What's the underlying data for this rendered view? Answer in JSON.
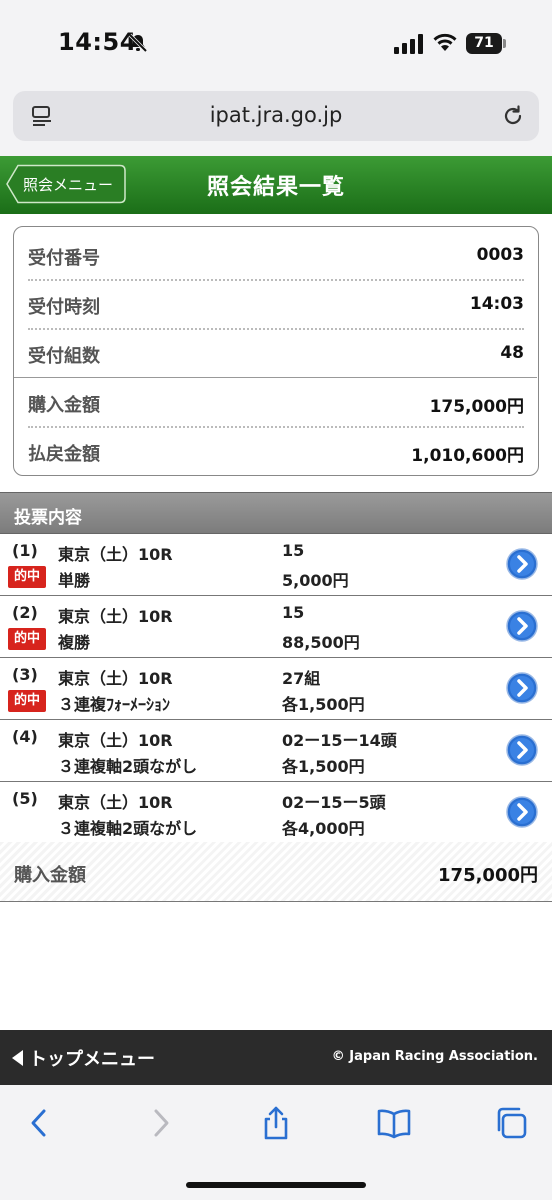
{
  "status_bar": {
    "time": "14:54",
    "battery": "71"
  },
  "browser": {
    "url": "ipat.jra.go.jp"
  },
  "header": {
    "back_label": "照会メニュー",
    "title": "照会結果一覧"
  },
  "summary": {
    "rows": [
      {
        "label": "受付番号",
        "value": "0003"
      },
      {
        "label": "受付時刻",
        "value": "14:03"
      },
      {
        "label": "受付組数",
        "value": "48"
      },
      {
        "label": "購入金額",
        "value": "175,000円"
      },
      {
        "label": "払戻金額",
        "value": "1,010,600円"
      }
    ]
  },
  "section": {
    "title": "投票内容"
  },
  "bets": [
    {
      "num": "(1)",
      "race": "東京（土）10R",
      "kind": "単勝",
      "selection": "15",
      "amount": "5,000円",
      "hit": true
    },
    {
      "num": "(2)",
      "race": "東京（土）10R",
      "kind": "複勝",
      "selection": "15",
      "amount": "88,500円",
      "hit": true
    },
    {
      "num": "(3)",
      "race": "東京（土）10R",
      "kind": "３連複ﾌｫｰﾒｰｼｮﾝ",
      "selection": "27組",
      "amount": "各1,500円",
      "hit": true
    },
    {
      "num": "(4)",
      "race": "東京（土）10R",
      "kind": "３連複軸2頭ながし",
      "selection": "02ー15ー14頭",
      "amount": "各1,500円",
      "hit": false
    },
    {
      "num": "(5)",
      "race": "東京（土）10R",
      "kind": "３連複軸2頭ながし",
      "selection": "02ー15ー5頭",
      "amount": "各4,000円",
      "hit": false
    }
  ],
  "hit_label": "的中",
  "total": {
    "label": "購入金額",
    "value": "175,000円"
  },
  "footer": {
    "top_menu": "トップメニュー",
    "copyright": "© Japan Racing Association."
  },
  "colors": {
    "header_green": "#2e8a2a",
    "hit_red": "#d7241d",
    "link_blue": "#2a6fd1"
  }
}
